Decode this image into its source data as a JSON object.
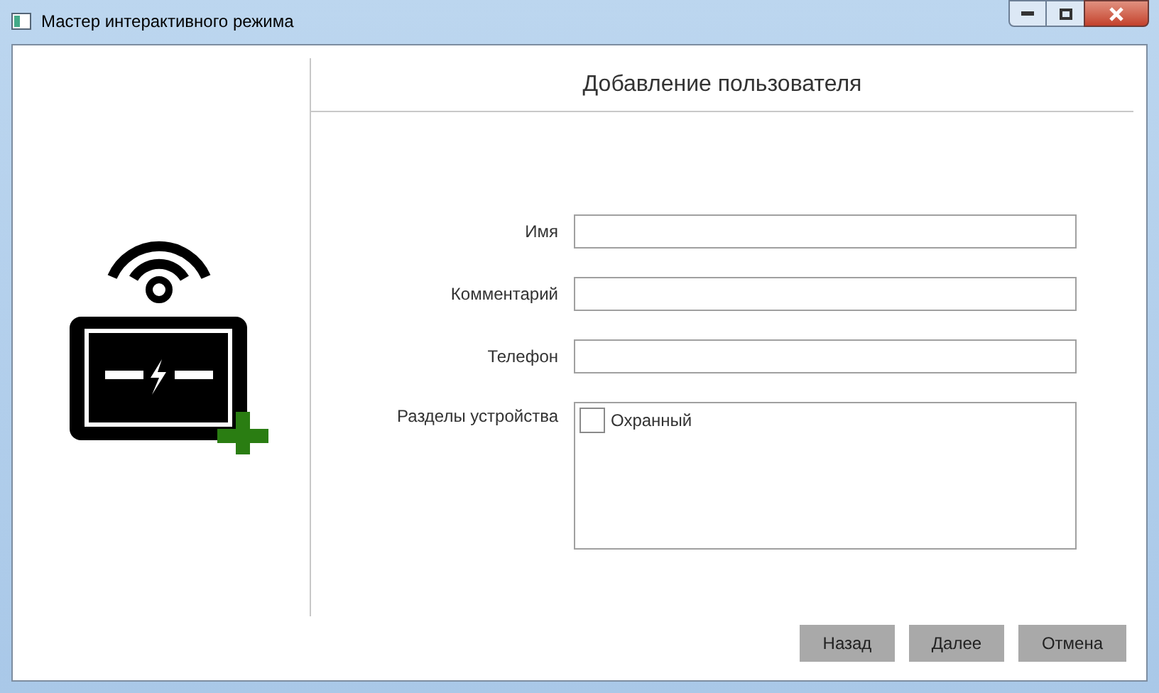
{
  "window": {
    "title": "Мастер интерактивного режима"
  },
  "heading": "Добавление пользователя",
  "fields": [
    {
      "kind": "text",
      "label": "Имя"
    },
    {
      "kind": "text",
      "label": "Комментарий"
    },
    {
      "kind": "text",
      "label": "Телефон"
    },
    {
      "kind": "list",
      "label": "Разделы устройства",
      "items": [
        {
          "label": "Охранный",
          "checked": false
        }
      ]
    }
  ],
  "buttons": [
    "Назад",
    "Далее",
    "Отмена"
  ]
}
